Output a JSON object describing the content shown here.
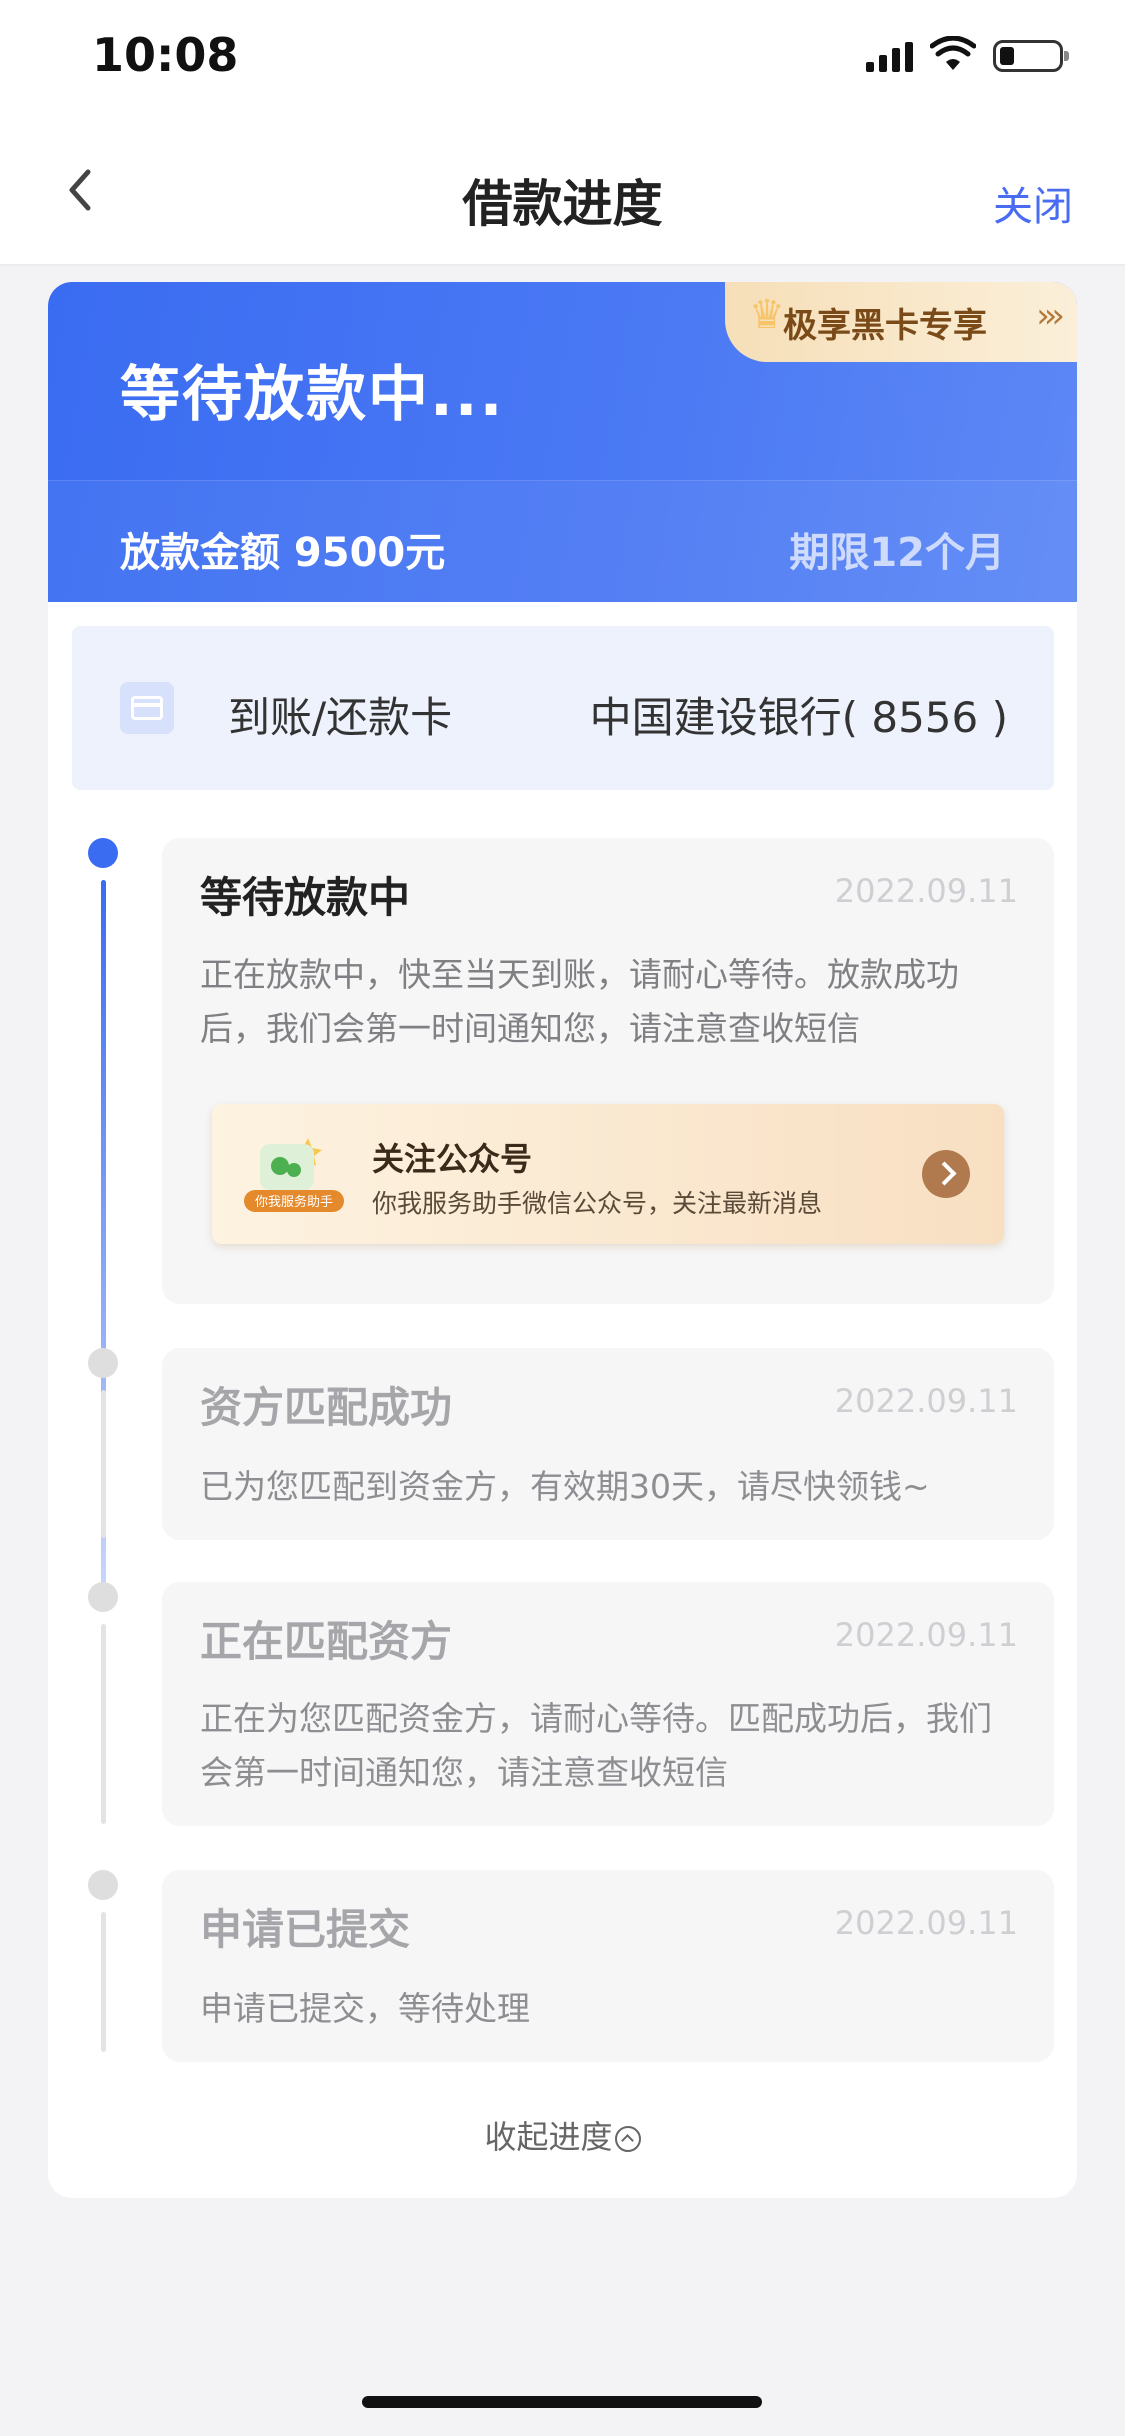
{
  "status_bar": {
    "time": "10:08"
  },
  "nav": {
    "title": "借款进度",
    "close_label": "关闭"
  },
  "hero": {
    "status": "等待放款中...",
    "amount_text": "放款金额 9500元",
    "term_text": "期限12个月",
    "badge_label": "极享黑卡专享",
    "badge_arrows": "›››"
  },
  "card": {
    "label": "到账/还款卡",
    "bank": "中国建设银行( 8556 )"
  },
  "steps": [
    {
      "title": "等待放款中",
      "date": "2022.09.11",
      "desc": "正在放款中，快至当天到账，请耐心等待。放款成功后，我们会第一时间通知您，请注意查收短信"
    },
    {
      "title": "资方匹配成功",
      "date": "2022.09.11",
      "desc": "已为您匹配到资金方，有效期30天，请尽快领钱~"
    },
    {
      "title": "正在匹配资方",
      "date": "2022.09.11",
      "desc": "正在为您匹配资金方，请耐心等待。匹配成功后，我们会第一时间通知您，请注意查收短信"
    },
    {
      "title": "申请已提交",
      "date": "2022.09.11",
      "desc": "申请已提交，等待处理"
    }
  ],
  "promo": {
    "title": "关注公众号",
    "subtitle": "你我服务助手微信公众号，关注最新消息",
    "image_tag": "你我服务助手"
  },
  "collapse_label": "收起进度",
  "colors": {
    "accent": "#3a6cf2",
    "close": "#4a6cf3",
    "badge_text": "#7a4a18"
  }
}
